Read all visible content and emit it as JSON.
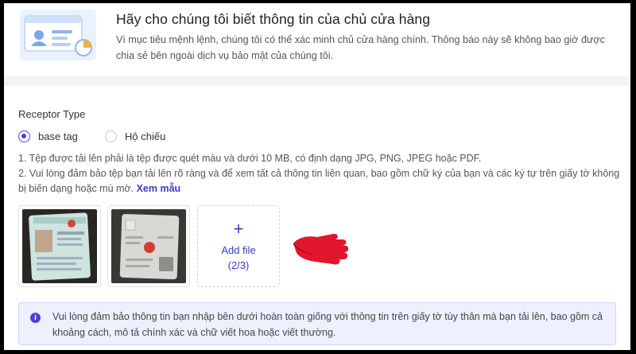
{
  "header": {
    "title": "Hãy cho chúng tôi biết thông tin của chủ cửa hàng",
    "description": "Vì mục tiêu mệnh lệnh, chúng tôi có thể xác minh chủ cửa hàng chính. Thông báo này sẽ không bao giờ được chia sẻ bên ngoài dịch vụ bảo mật của chúng tôi."
  },
  "form": {
    "section_label": "Receptor Type",
    "options": [
      {
        "label": "base tag",
        "selected": true
      },
      {
        "label": "Hộ chiếu",
        "selected": false
      }
    ],
    "note1": "1. Tệp được tải lên phải là tệp được quét màu và dưới 10 MB, có định dạng JPG, PNG, JPEG hoặc PDF.",
    "note2": "2. Vui lòng đảm bảo tệp bạn tải lên rõ ràng và để xem tất cả thông tin liên quan, bao gồm chữ ký của bạn và các ký tự trên giấy tờ không bị biến dạng hoặc mù mờ.",
    "sample_link": "Xem mẫu",
    "uploads": [
      {
        "icon": "id-card-photo-front"
      },
      {
        "icon": "id-card-photo-back"
      }
    ],
    "add_file": {
      "plus": "+",
      "label": "Add file",
      "count": "(2/3)"
    },
    "info": "Vui lòng đảm bảo thông tin bạn nhập bên dưới hoàn toàn giống với thông tin trên giấy tờ tùy thân mà bạn tải lên, bao gồm cả khoảng cách, mô tả chính xác và chữ viết hoa hoặc viết thường.",
    "info_icon": "i"
  },
  "colors": {
    "accent": "#4b3fd6",
    "link": "#3b3bc4",
    "hand": "#e2162c",
    "info_bg": "#eef0ff"
  }
}
